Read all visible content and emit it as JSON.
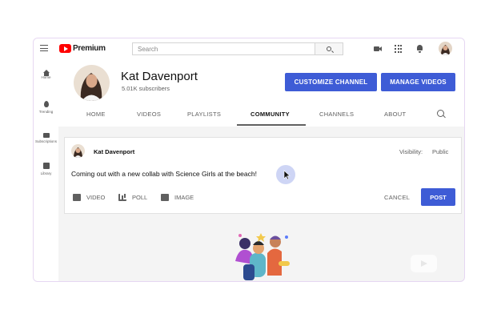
{
  "brand": {
    "name": "Premium"
  },
  "search": {
    "placeholder": "Search"
  },
  "sidebar": {
    "items": [
      {
        "label": "Home",
        "icon": "home-icon"
      },
      {
        "label": "Trending",
        "icon": "trending-icon"
      },
      {
        "label": "Subscriptions",
        "icon": "subscriptions-icon"
      },
      {
        "label": "Library",
        "icon": "library-icon"
      }
    ]
  },
  "channel": {
    "name": "Kat Davenport",
    "subscribers": "5.01K subscribers",
    "customize_label": "CUSTOMIZE CHANNEL",
    "manage_label": "MANAGE VIDEOS"
  },
  "tabs": [
    {
      "label": "HOME"
    },
    {
      "label": "VIDEOS"
    },
    {
      "label": "PLAYLISTS"
    },
    {
      "label": "COMMUNITY",
      "active": true
    },
    {
      "label": "CHANNELS"
    },
    {
      "label": "ABOUT"
    }
  ],
  "post": {
    "author": "Kat Davenport",
    "visibility_label": "Visibility:",
    "visibility_value": "Public",
    "text": "Coming out with a new collab with Science Girls at the beach!",
    "tools": [
      {
        "label": "VIDEO",
        "icon": "video-add-icon"
      },
      {
        "label": "POLL",
        "icon": "poll-icon"
      },
      {
        "label": "IMAGE",
        "icon": "image-icon"
      }
    ],
    "cancel_label": "CANCEL",
    "post_label": "POST"
  },
  "colors": {
    "accent": "#3e5cd6",
    "brand": "#ff0000"
  }
}
